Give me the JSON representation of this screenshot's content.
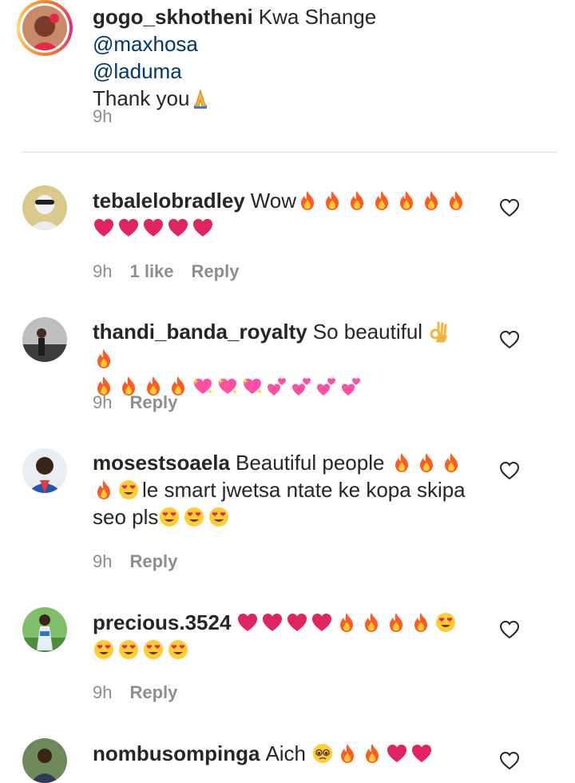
{
  "caption": {
    "username": "gogo_skhotheni",
    "text_before": "Kwa Shange",
    "mention1": "@maxhosa",
    "mention2": "@laduma",
    "text_after": "Thank you",
    "time": "9h"
  },
  "comments": [
    {
      "username": "tebalelobradley",
      "text": "Wow",
      "time": "9h",
      "likes": "1 like",
      "reply": "Reply"
    },
    {
      "username": "thandi_banda_royalty",
      "text": "So beautiful",
      "time": "9h",
      "reply": "Reply"
    },
    {
      "username": "mosestsoaela",
      "text": "Beautiful people",
      "text2": "le smart jwetsa ntate ke kopa skipa seo pls",
      "time": "9h",
      "reply": "Reply"
    },
    {
      "username": "precious.3524",
      "text": "",
      "time": "9h",
      "reply": "Reply"
    },
    {
      "username": "nombusompinga",
      "text": "Aich"
    }
  ],
  "colors": {
    "username": "#262626",
    "mention": "#00376b",
    "meta": "#8e8e8e",
    "divider": "#dbdbdb",
    "fire": "#ff5a1f",
    "heart_red": "#e0245e",
    "sparkle_heart": "#ff4fa3"
  },
  "icons": {
    "like": "heart-outline-icon",
    "pray": "folded-hands-emoji",
    "fire": "fire-emoji",
    "red_heart": "red-heart-emoji",
    "ok_hand": "ok-hand-emoji",
    "sparkling_heart": "sparkling-heart-emoji",
    "two_hearts": "two-hearts-emoji",
    "heart_eyes": "heart-eyes-emoji",
    "pleading": "pleading-face-emoji"
  }
}
